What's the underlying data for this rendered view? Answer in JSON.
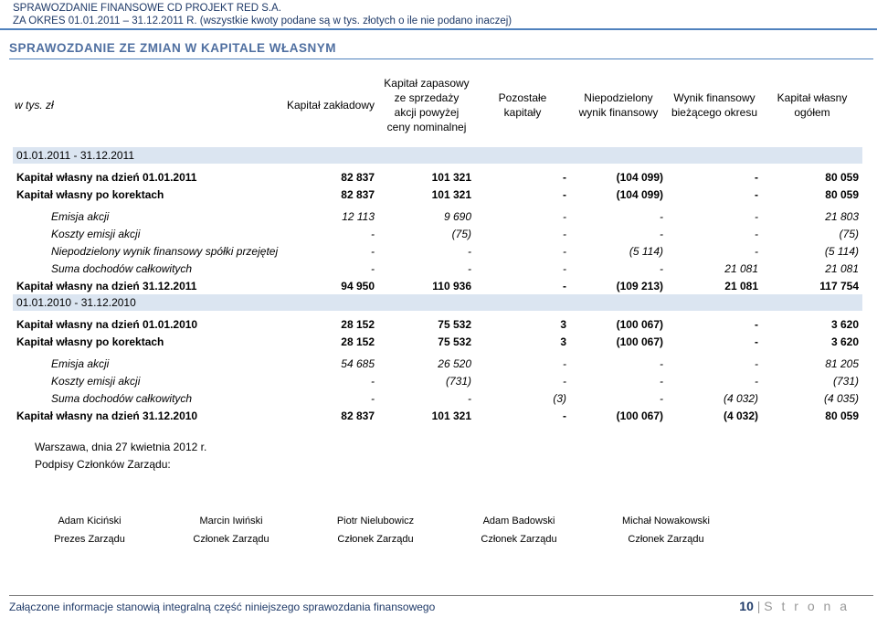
{
  "header": {
    "line1": "SPRAWOZDANIE FINANSOWE CD PROJEKT RED S.A.",
    "line2": "ZA OKRES 01.01.2011 – 31.12.2011 R.  (wszystkie kwoty podane są w tys. złotych o ile nie podano inaczej)"
  },
  "section_title": "SPRAWOZDANIE ZE ZMIAN W KAPITALE WŁASNYM",
  "table": {
    "columns": [
      "w tys. zł",
      "Kapitał zakładowy",
      "Kapitał zapasowy ze sprzedaży akcji powyżej ceny nominalnej",
      "Pozostałe kapitały",
      "Niepodzielony wynik finansowy",
      "Wynik finansowy bieżącego okresu",
      "Kapitał własny ogółem"
    ],
    "period1": "01.01.2011 - 31.12.2011",
    "rows1": [
      {
        "label": "Kapitał własny na dzień  01.01.2011",
        "values": [
          "82 837",
          "101 321",
          "-",
          "(104 099)",
          "-",
          "80 059"
        ]
      },
      {
        "label": "Kapitał własny po korektach",
        "values": [
          "82 837",
          "101 321",
          "-",
          "(104 099)",
          "-",
          "80 059"
        ]
      },
      {
        "label": "Emisja akcji",
        "values": [
          "12 113",
          "9 690",
          "-",
          "-",
          "-",
          "21 803"
        ]
      },
      {
        "label": "Koszty emisji akcji",
        "values": [
          "-",
          "(75)",
          "-",
          "-",
          "-",
          "(75)"
        ]
      },
      {
        "label": "Niepodzielony wynik finansowy spółki przejętej",
        "values": [
          "-",
          "-",
          "-",
          "(5 114)",
          "-",
          "(5 114)"
        ]
      },
      {
        "label": "Suma dochodów całkowitych",
        "values": [
          "-",
          "-",
          "-",
          "-",
          "21 081",
          "21 081"
        ]
      },
      {
        "label": "Kapitał własny na dzień  31.12.2011",
        "values": [
          "94 950",
          "110 936",
          "-",
          "(109 213)",
          "21 081",
          "117 754"
        ]
      }
    ],
    "period2": "01.01.2010 - 31.12.2010",
    "rows2": [
      {
        "label": "Kapitał własny na dzień  01.01.2010",
        "values": [
          "28 152",
          "75 532",
          "3",
          "(100 067)",
          "-",
          "3 620"
        ]
      },
      {
        "label": "Kapitał własny po korektach",
        "values": [
          "28 152",
          "75 532",
          "3",
          "(100 067)",
          "-",
          "3 620"
        ]
      },
      {
        "label": "Emisja akcji",
        "values": [
          "54 685",
          "26 520",
          "-",
          "-",
          "-",
          "81 205"
        ]
      },
      {
        "label": "Koszty emisji akcji",
        "values": [
          "-",
          "(731)",
          "-",
          "-",
          "-",
          "(731)"
        ]
      },
      {
        "label": "Suma dochodów całkowitych",
        "values": [
          "-",
          "-",
          "(3)",
          "-",
          "(4 032)",
          "(4 035)"
        ]
      },
      {
        "label": "Kapitał własny na dzień  31.12.2010",
        "values": [
          "82 837",
          "101 321",
          "-",
          "(100 067)",
          "(4 032)",
          "80 059"
        ]
      }
    ]
  },
  "place_date": "Warszawa, dnia 27 kwietnia 2012 r.",
  "signatures_label": "Podpisy Członków Zarządu:",
  "signatories": [
    {
      "name": "Adam Kiciński",
      "role": "Prezes Zarządu"
    },
    {
      "name": "Marcin Iwiński",
      "role": "Członek Zarządu"
    },
    {
      "name": "Piotr Nielubowicz",
      "role": "Członek Zarządu"
    },
    {
      "name": "Adam Badowski",
      "role": "Członek Zarządu"
    },
    {
      "name": "Michał Nowakowski",
      "role": "Członek Zarządu"
    }
  ],
  "footer": {
    "note": "Załączone informacje stanowią integralną część niniejszego sprawozdania finansowego",
    "page_number": "10",
    "separator": "|",
    "page_word": "S t r o n a"
  }
}
